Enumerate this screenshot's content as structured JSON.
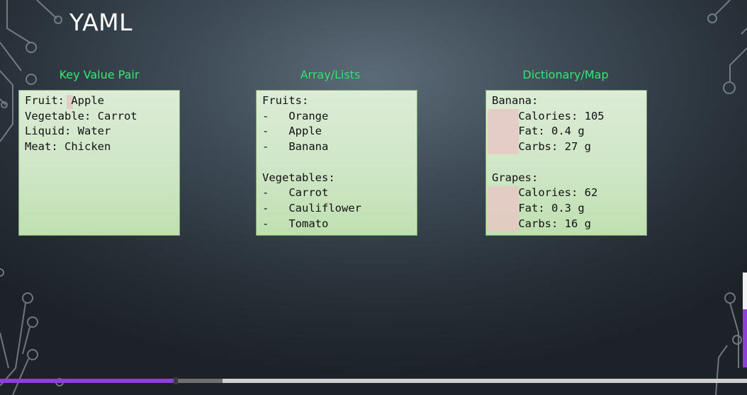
{
  "slide": {
    "title": "YAML"
  },
  "sections": [
    {
      "heading": "Key Value Pair",
      "lines": [
        "Fruit: Apple",
        "Vegetable: Carrot",
        "Liquid: Water",
        "Meat: Chicken",
        "",
        "",
        "",
        "",
        ""
      ]
    },
    {
      "heading": "Array/Lists",
      "lines": [
        "Fruits:",
        "-   Orange",
        "-   Apple",
        "-   Banana",
        "",
        "Vegetables:",
        "-   Carrot",
        "-   Cauliflower",
        "-   Tomato"
      ]
    },
    {
      "heading": "Dictionary/Map",
      "lines": [
        "Banana:",
        "    Calories: 105",
        "    Fat: 0.4 g",
        "    Carbs: 27 g",
        "",
        "Grapes:",
        "    Calories: 62",
        "    Fat: 0.3 g",
        "    Carbs: 16 g"
      ]
    }
  ],
  "player": {
    "progress_fraction": 0.235,
    "buffered_fraction": 0.298
  },
  "colors": {
    "heading": "#3ee07a",
    "box_fill": "#d4e9cc",
    "highlight": "#e6c8c4",
    "accent": "#8f3fd6"
  }
}
